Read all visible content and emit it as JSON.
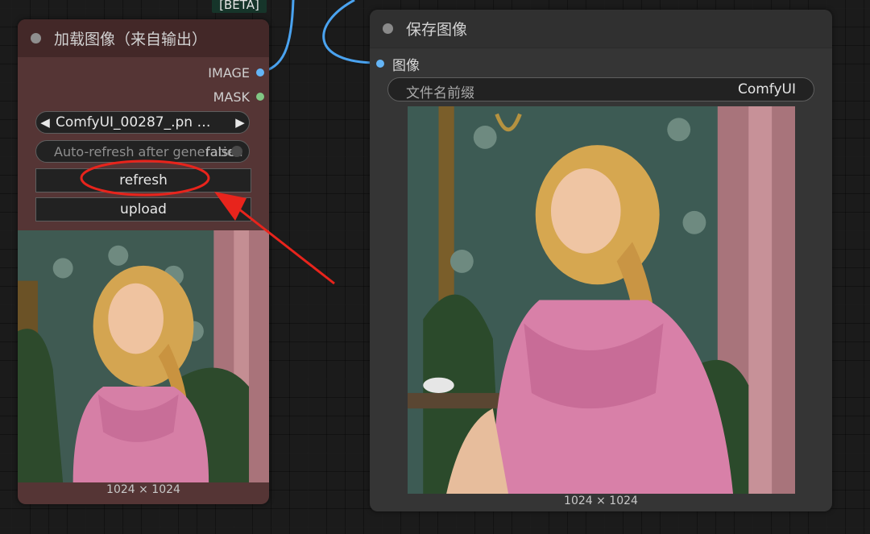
{
  "beta_tag": "[BETA]",
  "load_node": {
    "title": "加载图像（来自输出）",
    "outputs": [
      {
        "label": "IMAGE",
        "color": "#64b5f6"
      },
      {
        "label": "MASK",
        "color": "#81c784"
      }
    ],
    "image_combo": {
      "value": "ComfyUI_00287_.pn …",
      "prev_icon": "◀",
      "next_icon": "▶"
    },
    "auto_refresh": {
      "label": "Auto-refresh after generation",
      "value": "false"
    },
    "refresh_label": "refresh",
    "upload_label": "upload",
    "dimensions": "1024 × 1024"
  },
  "save_node": {
    "title": "保存图像",
    "input": {
      "label": "图像",
      "color": "#64b5f6"
    },
    "filename_prefix": {
      "label": "文件名前缀",
      "value": "ComfyUI"
    },
    "dimensions": "1024 × 1024"
  },
  "annotation": {
    "color": "#e8241c"
  }
}
